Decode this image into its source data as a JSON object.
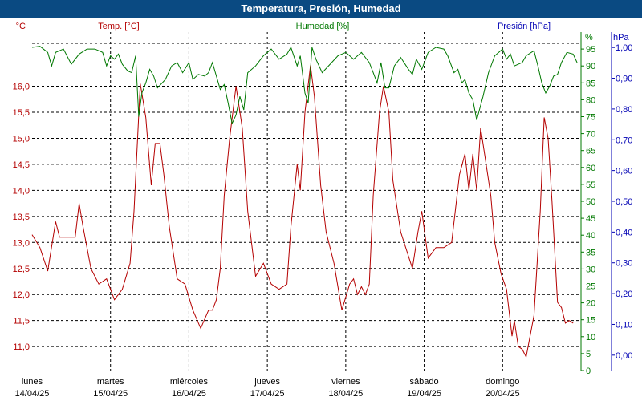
{
  "window": {
    "title": "Temperatura, Presión, Humedad"
  },
  "colors": {
    "temp": "#b40000",
    "humidity": "#007800",
    "pressure": "#0000b4",
    "titlebar": "#0a4a82",
    "grid": "#000000"
  },
  "chart_data": {
    "type": "line",
    "title": "Temperatura, Presión, Humedad",
    "grid": true,
    "legend": "top",
    "axes": {
      "temp": {
        "label": "Temp. [°C]",
        "unit": "°C",
        "range": [
          10.54,
          17.04
        ],
        "ticks": [
          11.0,
          11.5,
          12.0,
          12.5,
          13.0,
          13.5,
          14.0,
          14.5,
          15.0,
          15.5,
          16.0
        ],
        "tick_labels": [
          "11,0",
          "11,5",
          "12,0",
          "12,5",
          "13,0",
          "13,5",
          "14,0",
          "14,5",
          "15,0",
          "15,5",
          "16,0"
        ]
      },
      "humidity": {
        "label": "Humedad [%]",
        "unit": "%",
        "range": [
          0,
          100
        ],
        "ticks": [
          0,
          5,
          10,
          15,
          20,
          25,
          30,
          35,
          40,
          45,
          50,
          55,
          60,
          65,
          70,
          75,
          80,
          85,
          90,
          95
        ],
        "tick_labels": [
          "0",
          "5",
          "10",
          "15",
          "20",
          "25",
          "30",
          "35",
          "40",
          "45",
          "50",
          "55",
          "60",
          "65",
          "70",
          "75",
          "80",
          "85",
          "90",
          "95"
        ]
      },
      "pressure": {
        "label": "Presión [hPa]",
        "unit": "hPa",
        "range": [
          -0.05,
          1.05
        ],
        "ticks": [
          0.0,
          0.1,
          0.2,
          0.3,
          0.4,
          0.5,
          0.6,
          0.7,
          0.8,
          0.9,
          1.0
        ],
        "tick_labels": [
          "0,00",
          "0,10",
          "0,20",
          "0,30",
          "0,40",
          "0,50",
          "0,60",
          "0,70",
          "0,80",
          "0,90",
          "1,00"
        ]
      }
    },
    "x_axis": {
      "range": [
        0,
        7
      ],
      "tick_days": [
        {
          "day": "lunes",
          "date": "14/04/25"
        },
        {
          "day": "martes",
          "date": "15/04/25"
        },
        {
          "day": "miércoles",
          "date": "16/04/25"
        },
        {
          "day": "jueves",
          "date": "17/04/25"
        },
        {
          "day": "viernes",
          "date": "18/04/25"
        },
        {
          "day": "sábado",
          "date": "19/04/25"
        },
        {
          "day": "domingo",
          "date": "20/04/25"
        }
      ]
    },
    "series": [
      {
        "name": "Temp. [°C]",
        "axis": "temp",
        "points": [
          [
            0.0,
            13.15
          ],
          [
            0.1,
            12.9
          ],
          [
            0.2,
            12.45
          ],
          [
            0.3,
            13.4
          ],
          [
            0.35,
            13.1
          ],
          [
            0.45,
            13.1
          ],
          [
            0.55,
            13.1
          ],
          [
            0.6,
            13.75
          ],
          [
            0.65,
            13.3
          ],
          [
            0.75,
            12.5
          ],
          [
            0.85,
            12.2
          ],
          [
            0.95,
            12.3
          ],
          [
            1.05,
            11.9
          ],
          [
            1.15,
            12.1
          ],
          [
            1.25,
            12.6
          ],
          [
            1.3,
            13.6
          ],
          [
            1.38,
            16.05
          ],
          [
            1.45,
            15.4
          ],
          [
            1.52,
            14.1
          ],
          [
            1.57,
            14.9
          ],
          [
            1.63,
            14.9
          ],
          [
            1.68,
            14.3
          ],
          [
            1.75,
            13.3
          ],
          [
            1.85,
            12.3
          ],
          [
            1.95,
            12.2
          ],
          [
            2.05,
            11.7
          ],
          [
            2.15,
            11.35
          ],
          [
            2.25,
            11.7
          ],
          [
            2.3,
            11.7
          ],
          [
            2.35,
            11.9
          ],
          [
            2.4,
            12.5
          ],
          [
            2.45,
            13.9
          ],
          [
            2.52,
            15.0
          ],
          [
            2.6,
            16.0
          ],
          [
            2.68,
            15.2
          ],
          [
            2.75,
            13.6
          ],
          [
            2.85,
            12.35
          ],
          [
            2.95,
            12.6
          ],
          [
            3.05,
            12.2
          ],
          [
            3.15,
            12.1
          ],
          [
            3.25,
            12.2
          ],
          [
            3.3,
            13.3
          ],
          [
            3.38,
            14.5
          ],
          [
            3.42,
            14.0
          ],
          [
            3.48,
            15.5
          ],
          [
            3.55,
            16.4
          ],
          [
            3.6,
            15.8
          ],
          [
            3.68,
            14.1
          ],
          [
            3.75,
            13.2
          ],
          [
            3.85,
            12.6
          ],
          [
            3.95,
            11.7
          ],
          [
            4.05,
            12.2
          ],
          [
            4.1,
            12.3
          ],
          [
            4.15,
            12.0
          ],
          [
            4.2,
            12.15
          ],
          [
            4.25,
            12.0
          ],
          [
            4.3,
            12.2
          ],
          [
            4.35,
            13.9
          ],
          [
            4.43,
            15.5
          ],
          [
            4.48,
            16.0
          ],
          [
            4.55,
            15.5
          ],
          [
            4.6,
            14.2
          ],
          [
            4.7,
            13.2
          ],
          [
            4.85,
            12.5
          ],
          [
            4.92,
            13.2
          ],
          [
            4.97,
            13.6
          ],
          [
            5.05,
            12.7
          ],
          [
            5.15,
            12.9
          ],
          [
            5.25,
            12.9
          ],
          [
            5.35,
            13.0
          ],
          [
            5.45,
            14.3
          ],
          [
            5.52,
            14.7
          ],
          [
            5.57,
            14.0
          ],
          [
            5.62,
            14.7
          ],
          [
            5.67,
            14.0
          ],
          [
            5.72,
            15.2
          ],
          [
            5.78,
            14.6
          ],
          [
            5.85,
            13.9
          ],
          [
            5.9,
            13.0
          ],
          [
            5.98,
            12.4
          ],
          [
            6.05,
            12.1
          ],
          [
            6.12,
            11.2
          ],
          [
            6.15,
            11.5
          ],
          [
            6.2,
            11.0
          ],
          [
            6.25,
            10.95
          ],
          [
            6.3,
            10.8
          ],
          [
            6.4,
            11.6
          ],
          [
            6.48,
            13.6
          ],
          [
            6.53,
            15.4
          ],
          [
            6.58,
            15.0
          ],
          [
            6.63,
            13.8
          ],
          [
            6.7,
            11.85
          ],
          [
            6.75,
            11.75
          ],
          [
            6.8,
            11.45
          ],
          [
            6.85,
            11.5
          ],
          [
            6.9,
            11.45
          ]
        ]
      },
      {
        "name": "Humedad [%]",
        "axis": "humidity",
        "points": [
          [
            0.0,
            95.5
          ],
          [
            0.1,
            95.8
          ],
          [
            0.2,
            94.0
          ],
          [
            0.25,
            90.0
          ],
          [
            0.3,
            94.0
          ],
          [
            0.4,
            95.0
          ],
          [
            0.5,
            90.5
          ],
          [
            0.6,
            93.5
          ],
          [
            0.7,
            95.0
          ],
          [
            0.8,
            95.0
          ],
          [
            0.9,
            94.0
          ],
          [
            0.95,
            90.0
          ],
          [
            1.0,
            93.0
          ],
          [
            1.05,
            92.0
          ],
          [
            1.1,
            93.5
          ],
          [
            1.15,
            90.5
          ],
          [
            1.22,
            88.5
          ],
          [
            1.27,
            88.0
          ],
          [
            1.32,
            93.0
          ],
          [
            1.36,
            75.0
          ],
          [
            1.4,
            82.0
          ],
          [
            1.45,
            85.0
          ],
          [
            1.5,
            89.0
          ],
          [
            1.55,
            87.0
          ],
          [
            1.6,
            83.5
          ],
          [
            1.7,
            86.0
          ],
          [
            1.78,
            90.0
          ],
          [
            1.85,
            91.0
          ],
          [
            1.92,
            88.0
          ],
          [
            2.0,
            91.0
          ],
          [
            2.05,
            86.0
          ],
          [
            2.12,
            87.5
          ],
          [
            2.2,
            87.0
          ],
          [
            2.25,
            88.0
          ],
          [
            2.3,
            91.0
          ],
          [
            2.35,
            87.0
          ],
          [
            2.4,
            83.0
          ],
          [
            2.45,
            84.5
          ],
          [
            2.5,
            79.0
          ],
          [
            2.55,
            73.0
          ],
          [
            2.6,
            75.5
          ],
          [
            2.65,
            81.0
          ],
          [
            2.7,
            77.0
          ],
          [
            2.75,
            88.0
          ],
          [
            2.85,
            90.0
          ],
          [
            2.95,
            93.0
          ],
          [
            3.05,
            95.0
          ],
          [
            3.15,
            92.0
          ],
          [
            3.25,
            93.5
          ],
          [
            3.3,
            95.5
          ],
          [
            3.38,
            90.0
          ],
          [
            3.42,
            93.0
          ],
          [
            3.48,
            82.0
          ],
          [
            3.52,
            79.0
          ],
          [
            3.57,
            95.5
          ],
          [
            3.62,
            92.0
          ],
          [
            3.7,
            88.0
          ],
          [
            3.8,
            90.5
          ],
          [
            3.9,
            93.0
          ],
          [
            4.0,
            94.0
          ],
          [
            4.1,
            92.0
          ],
          [
            4.2,
            94.0
          ],
          [
            4.3,
            91.0
          ],
          [
            4.35,
            88.0
          ],
          [
            4.4,
            85.0
          ],
          [
            4.45,
            91.0
          ],
          [
            4.5,
            83.5
          ],
          [
            4.55,
            83.5
          ],
          [
            4.62,
            90.0
          ],
          [
            4.7,
            92.5
          ],
          [
            4.8,
            89.0
          ],
          [
            4.85,
            87.5
          ],
          [
            4.9,
            92.0
          ],
          [
            4.97,
            89.0
          ],
          [
            5.05,
            94.0
          ],
          [
            5.15,
            95.5
          ],
          [
            5.25,
            95.0
          ],
          [
            5.3,
            93.0
          ],
          [
            5.38,
            88.0
          ],
          [
            5.43,
            89.0
          ],
          [
            5.48,
            85.0
          ],
          [
            5.52,
            86.0
          ],
          [
            5.57,
            82.0
          ],
          [
            5.62,
            80.0
          ],
          [
            5.67,
            74.0
          ],
          [
            5.75,
            81.0
          ],
          [
            5.82,
            88.0
          ],
          [
            5.9,
            93.0
          ],
          [
            6.0,
            95.0
          ],
          [
            6.05,
            92.0
          ],
          [
            6.1,
            93.5
          ],
          [
            6.15,
            90.0
          ],
          [
            6.2,
            90.5
          ],
          [
            6.25,
            91.0
          ],
          [
            6.3,
            93.0
          ],
          [
            6.4,
            94.5
          ],
          [
            6.45,
            90.0
          ],
          [
            6.5,
            85.0
          ],
          [
            6.55,
            82.0
          ],
          [
            6.6,
            84.0
          ],
          [
            6.65,
            87.0
          ],
          [
            6.7,
            87.5
          ],
          [
            6.75,
            91.0
          ],
          [
            6.82,
            94.0
          ],
          [
            6.9,
            93.5
          ],
          [
            6.95,
            91.0
          ]
        ]
      }
    ]
  }
}
